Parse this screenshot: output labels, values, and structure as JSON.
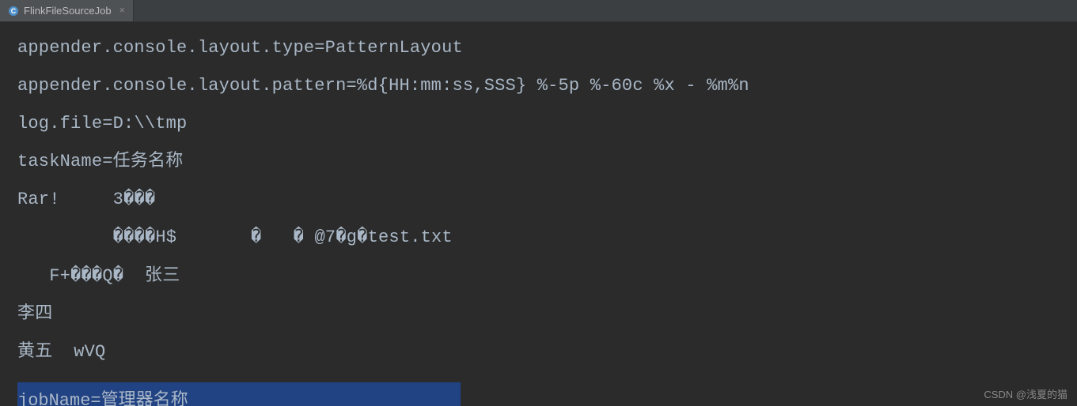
{
  "tab": {
    "label": "FlinkFileSourceJob",
    "icon_name": "java-class-icon"
  },
  "editor": {
    "lines": [
      "appender.console.layout.type=PatternLayout",
      "appender.console.layout.pattern=%d{HH:mm:ss,SSS} %-5p %-60c %x - %m%n",
      "log.file=D:\\\\tmp",
      "taskName=任务名称",
      "Rar!     3���",
      "         ����H$       �   � @7�g�test.txt",
      "   F+���Q�  张三",
      "李四",
      "黄五  wVQ"
    ],
    "partial_line": "jobName=管理器名称"
  },
  "watermark": "CSDN @浅夏的猫"
}
